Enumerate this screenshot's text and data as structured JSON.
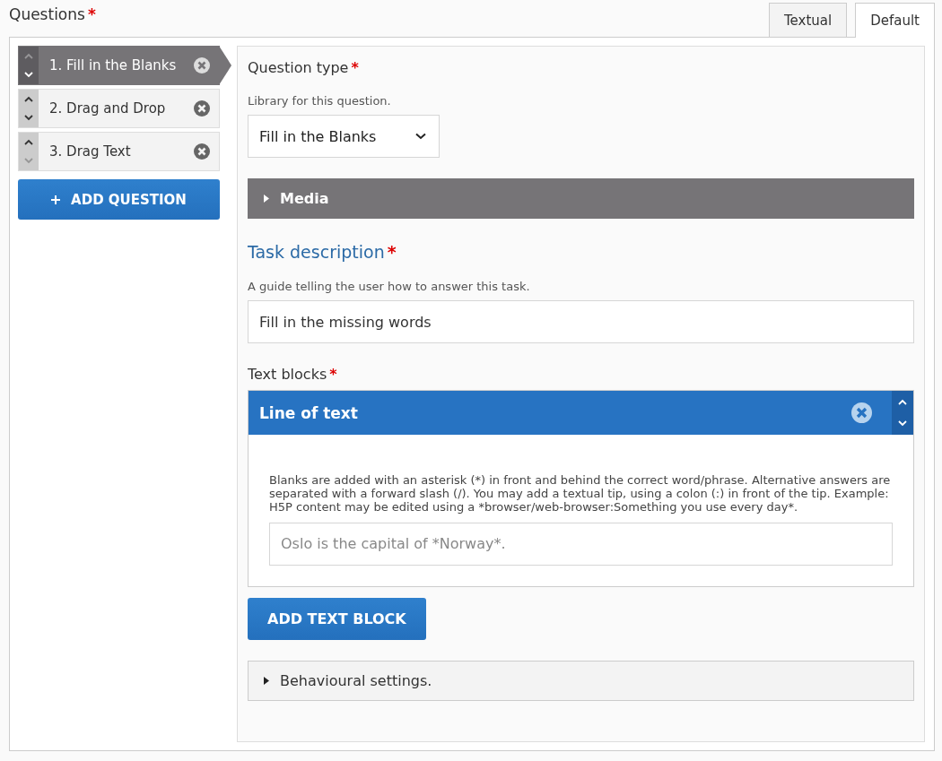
{
  "header": {
    "title": "Questions",
    "required_mark": "*"
  },
  "tabs": [
    {
      "label": "Textual",
      "selected": false
    },
    {
      "label": "Default",
      "selected": true
    }
  ],
  "questions": [
    {
      "label": "1. Fill in the Blanks",
      "selected": true,
      "up_disabled": true,
      "down_disabled": false
    },
    {
      "label": "2. Drag and Drop",
      "selected": false,
      "up_disabled": false,
      "down_disabled": false
    },
    {
      "label": "3. Drag Text",
      "selected": false,
      "up_disabled": false,
      "down_disabled": true
    }
  ],
  "add_question": "ADD QUESTION",
  "question_type": {
    "label": "Question type",
    "required_mark": "*",
    "description": "Library for this question.",
    "value": "Fill in the Blanks"
  },
  "media": {
    "label": "Media",
    "expanded": false
  },
  "task_description": {
    "label": "Task description",
    "required_mark": "*",
    "description": "A guide telling the user how to answer this task.",
    "value": "Fill in the missing words"
  },
  "text_blocks": {
    "label": "Text blocks",
    "required_mark": "*",
    "items": [
      {
        "title": "Line of text",
        "help": "Blanks are added with an asterisk (*) in front and behind the correct word/phrase. Alternative answers are separated with a forward slash (/). You may add a textual tip, using a colon (:) in front of the tip. Example: H5P content may be edited using a *browser/web-browser:Something you use every day*.",
        "placeholder": "Oslo is the capital of *Norway*."
      }
    ],
    "add_button": "ADD TEXT BLOCK"
  },
  "behavioural": {
    "label": "Behavioural settings.",
    "expanded": false
  }
}
